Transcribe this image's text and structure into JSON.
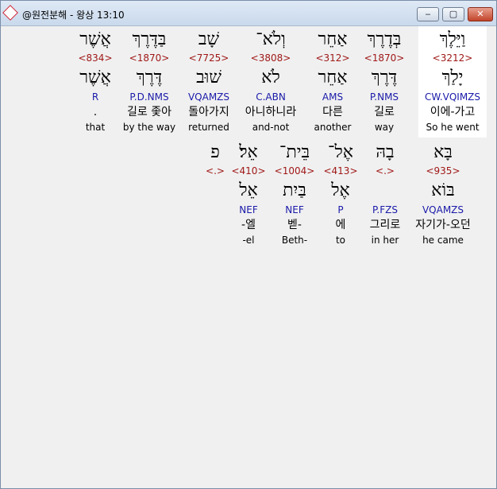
{
  "window": {
    "title": "@원전분해 - 왕상 13:10",
    "buttons": {
      "minimize": "‒",
      "maximize": "▢",
      "close": "✕"
    }
  },
  "rows": [
    {
      "words": [
        {
          "hebrew": "וַיֵּלֶךְ",
          "strong": "<3212>",
          "lemma": "יָלַךְ",
          "parse": "CW.VQIMZS",
          "korean": "이에-가고",
          "english": "So he went",
          "highlighted": true
        },
        {
          "hebrew": "בְּדֶרֶךְ",
          "strong": "<1870>",
          "lemma": "דֶּרֶךְ",
          "parse": "P.NMS",
          "korean": "길로",
          "english": "way"
        },
        {
          "hebrew": "אַחֵר",
          "strong": "<312>",
          "lemma": "אַחֵר",
          "parse": "AMS",
          "korean": "다른",
          "english": "another"
        },
        {
          "hebrew": "וְלֹא־",
          "strong": "<3808>",
          "lemma": "לֹא",
          "parse": "C.ABN",
          "korean": "아니하니라",
          "english": "and-not"
        },
        {
          "hebrew": "שָׁב",
          "strong": "<7725>",
          "lemma": "שׁוּב",
          "parse": "VQAMZS",
          "korean": "돌아가지",
          "english": "returned"
        },
        {
          "hebrew": "בַּדֶּרֶךְ",
          "strong": "<1870>",
          "lemma": "דֶּרֶךְ",
          "parse": "P.D.NMS",
          "korean": "길로 좇아",
          "english": "by the way"
        },
        {
          "hebrew": "אֲשֶׁר",
          "strong": "<834>",
          "lemma": "אֲשֶׁר",
          "parse": "R",
          "korean": ".",
          "english": "that"
        }
      ]
    },
    {
      "words": [
        {
          "hebrew": "בָּא",
          "strong": "<935>",
          "lemma": "בּוֹא",
          "parse": "VQAMZS",
          "korean": "자기가-오던",
          "english": "he came"
        },
        {
          "hebrew": "בָהּ",
          "strong": "<.>",
          "lemma": "",
          "parse": "P.FZS",
          "korean": "그리로",
          "english": "in her"
        },
        {
          "hebrew": "אֶל־",
          "strong": "<413>",
          "lemma": "אֶל",
          "parse": "P",
          "korean": "에",
          "english": "to"
        },
        {
          "hebrew": "בֵּית־",
          "strong": "<1004>",
          "lemma": "בַּיִת",
          "parse": "NEF",
          "korean": "벧-",
          "english": "Beth-"
        },
        {
          "hebrew": "אֵל׃",
          "strong": "<410>",
          "lemma": "אֵל",
          "parse": "NEF",
          "korean": "-엘",
          "english": "-el"
        },
        {
          "hebrew": "פ",
          "strong": "<.>",
          "lemma": "",
          "parse": "",
          "korean": "",
          "english": ""
        }
      ]
    }
  ]
}
